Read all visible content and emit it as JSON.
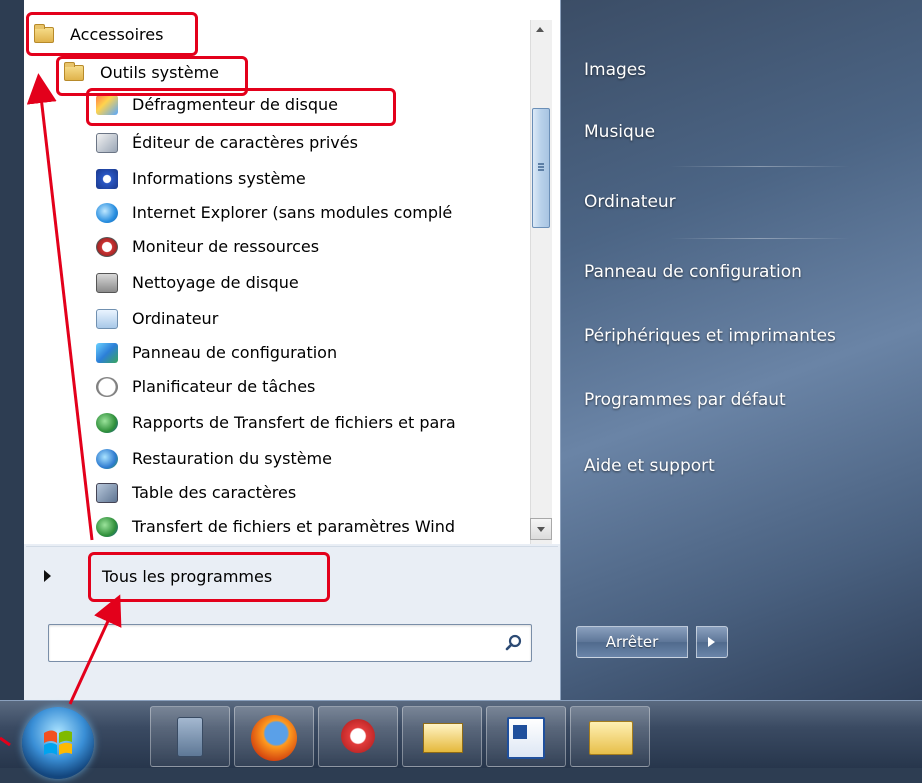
{
  "start_menu": {
    "programs": [
      {
        "label": "Accessoires",
        "icon": "folder-icon"
      },
      {
        "label": "Outils système",
        "icon": "folder-icon"
      },
      {
        "label": "Défragmenteur de disque",
        "icon": "defrag-icon"
      },
      {
        "label": "Éditeur de caractères privés",
        "icon": "char-editor-icon"
      },
      {
        "label": "Informations système",
        "icon": "system-info-icon"
      },
      {
        "label": "Internet Explorer (sans modules complé",
        "icon": "ie-icon"
      },
      {
        "label": "Moniteur de ressources",
        "icon": "resource-monitor-icon"
      },
      {
        "label": "Nettoyage de disque",
        "icon": "disk-cleanup-icon"
      },
      {
        "label": "Ordinateur",
        "icon": "computer-icon"
      },
      {
        "label": "Panneau de configuration",
        "icon": "control-panel-icon"
      },
      {
        "label": "Planificateur de tâches",
        "icon": "task-scheduler-icon"
      },
      {
        "label": "Rapports de Transfert de fichiers et para",
        "icon": "transfer-report-icon"
      },
      {
        "label": "Restauration du système",
        "icon": "system-restore-icon"
      },
      {
        "label": "Table des caractères",
        "icon": "char-map-icon"
      },
      {
        "label": "Transfert de fichiers et paramètres Wind",
        "icon": "easy-transfer-icon"
      }
    ],
    "all_programs_label": "Tous les programmes",
    "search": {
      "value": "",
      "placeholder": ""
    }
  },
  "right_pane": {
    "items": [
      "Images",
      "Musique",
      "Ordinateur",
      "Panneau de configuration",
      "Périphériques et imprimantes",
      "Programmes par défaut",
      "Aide et support"
    ],
    "shutdown_label": "Arrêter"
  },
  "taskbar": {
    "buttons": [
      "calculator-icon",
      "firefox-icon",
      "snipping-tool-icon",
      "mail-icon",
      "word-icon",
      "explorer-icon"
    ]
  },
  "colors": {
    "annotation_red": "#e3001b",
    "right_pane": "#4c6585"
  }
}
